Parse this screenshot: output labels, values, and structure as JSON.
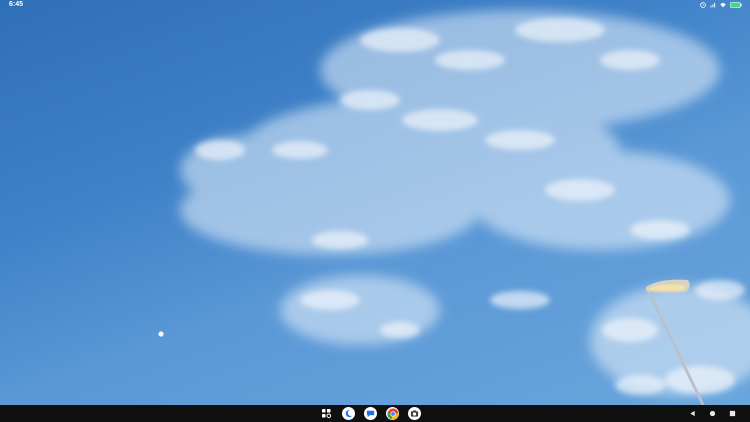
{
  "statusbar": {
    "time": "6:45",
    "icons": [
      "clock-icon",
      "wifi-icon",
      "signal-icon",
      "battery-icon"
    ],
    "battery_color": "#3ddc84"
  },
  "taskbar": {
    "apps": [
      {
        "name": "app-grid",
        "icon": "apps-icon"
      },
      {
        "name": "clock-app",
        "icon": "moon-icon"
      },
      {
        "name": "messages-app",
        "icon": "chat-icon"
      },
      {
        "name": "chrome-app",
        "icon": "chrome-icon"
      },
      {
        "name": "camera-app",
        "icon": "camera-icon"
      }
    ],
    "nav": [
      "back-icon",
      "home-icon",
      "recents-icon"
    ]
  },
  "colors": {
    "sky_top": "#2f6fb8",
    "sky_bottom": "#6aa5dc",
    "taskbar": "#101010"
  }
}
